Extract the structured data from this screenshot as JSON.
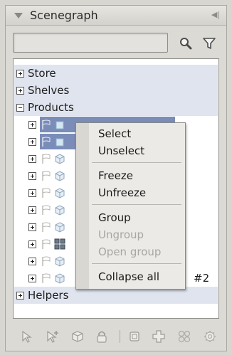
{
  "panel": {
    "title": "Scenegraph"
  },
  "search": {
    "value": "",
    "placeholder": ""
  },
  "tree": {
    "top_items": [
      {
        "label": "Store",
        "expanded": false
      },
      {
        "label": "Shelves",
        "expanded": false
      },
      {
        "label": "Products",
        "expanded": true
      },
      {
        "label": "Helpers",
        "expanded": false
      }
    ],
    "product_children_count_visible": 10,
    "visible_suffix": "#2"
  },
  "context_menu": {
    "items": [
      {
        "label": "Select",
        "enabled": true
      },
      {
        "label": "Unselect",
        "enabled": true
      },
      {
        "label": "Freeze",
        "enabled": true
      },
      {
        "label": "Unfreeze",
        "enabled": true
      },
      {
        "label": "Group",
        "enabled": true
      },
      {
        "label": "Ungroup",
        "enabled": false
      },
      {
        "label": "Open group",
        "enabled": false
      },
      {
        "label": "Collapse all",
        "enabled": true
      }
    ]
  },
  "colors": {
    "selection": "#7a8cb8",
    "row_highlight": "#dfe4ee",
    "panel_bg": "#dcdad4"
  },
  "icons": {
    "header": [
      "collapse-triangle-icon",
      "dock-icon"
    ],
    "search": [
      "search-icon",
      "filter-icon"
    ],
    "toolbar": [
      "select-icon",
      "select-add-icon",
      "object-icon",
      "lock-icon",
      "ungroup-icon",
      "add-icon",
      "group-icon",
      "settings-icon"
    ]
  }
}
